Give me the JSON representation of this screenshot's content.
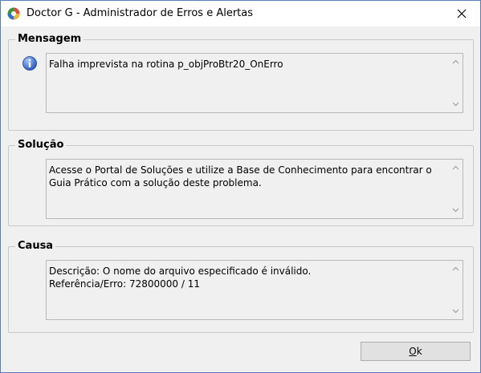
{
  "window": {
    "title": "Doctor G - Administrador de Erros e Alertas",
    "close_icon": "close-icon",
    "app_icon": "doctor-g-app-icon"
  },
  "mensagem": {
    "label": "Mensagem",
    "icon": "info-icon",
    "text": "Falha imprevista na rotina p_objProBtr20_OnErro"
  },
  "solucao": {
    "label": "Solução",
    "text": "Acesse o Portal de Soluções e utilize a Base de Conhecimento para encontrar o Guia Prático com a solução deste problema."
  },
  "causa": {
    "label": "Causa",
    "line1": "Descrição: O nome do arquivo especificado é inválido.",
    "line2": "Referência/Erro: 72800000 / 11"
  },
  "buttons": {
    "ok_first": "O",
    "ok_rest": "k"
  },
  "colors": {
    "window_bg": "#f0f0f0",
    "border": "#5a7fb8",
    "button_bg": "#e1e1e1"
  }
}
